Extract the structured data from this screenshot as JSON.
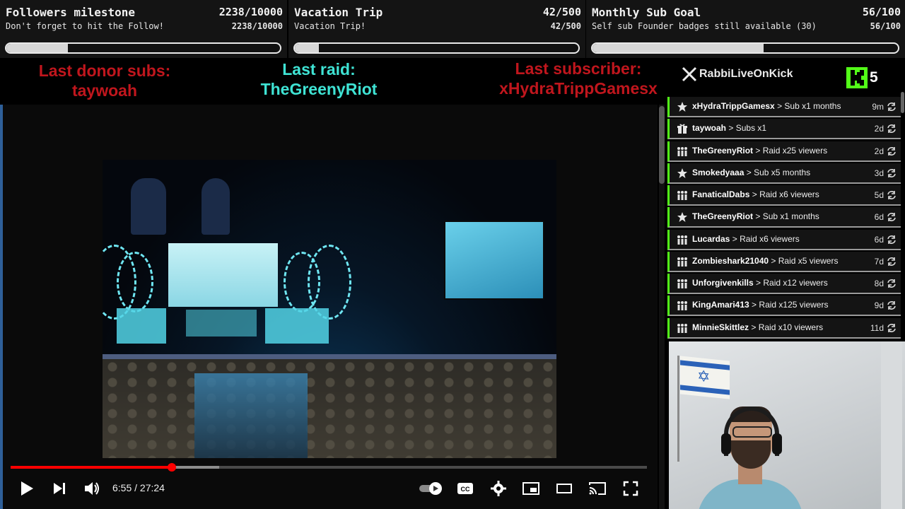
{
  "goals": [
    {
      "title": "Followers milestone",
      "count": "2238/10000",
      "subtitle": "Don't forget to hit the Follow!",
      "sub_count": "2238/10000",
      "progress": 0.2238
    },
    {
      "title": "Vacation Trip",
      "count": "42/500",
      "subtitle": "Vacation Trip!",
      "sub_count": "42/500",
      "progress": 0.084
    },
    {
      "title": "Monthly Sub Goal",
      "count": "56/100",
      "subtitle": "Self sub Founder badges still available (30)",
      "sub_count": "56/100",
      "progress": 0.56
    }
  ],
  "last_events": {
    "donor": {
      "label": "Last donor subs:",
      "value": "taywoah",
      "color": "#c0161d"
    },
    "raid": {
      "label": "Last raid:",
      "value": "TheGreenyRiot",
      "color": "#3fe3d4"
    },
    "subscriber": {
      "label": "Last subscriber:",
      "value": "xHydraTrippGamesx",
      "color": "#c0161d"
    }
  },
  "player": {
    "time": "6:55 / 27:24",
    "played_fraction": 0.253,
    "buffered_fraction": 0.328,
    "colors": {
      "played": "#ff0000",
      "buffered": "#8d8d8d",
      "track": "#4a4a4a"
    }
  },
  "brand": {
    "name": "RabbiLiveOnKick",
    "kick_count": "5",
    "kick_color": "#53fc18"
  },
  "events": [
    {
      "icon": "star-icon",
      "user": "xHydraTrippGamesx",
      "action": "Sub x1 months",
      "time": "9m"
    },
    {
      "icon": "gift-icon",
      "user": "taywoah",
      "action": "Subs x1",
      "time": "2d"
    },
    {
      "icon": "raid-icon",
      "user": "TheGreenyRiot",
      "action": "Raid x25 viewers",
      "time": "2d"
    },
    {
      "icon": "star-icon",
      "user": "Smokedyaaa",
      "action": "Sub x5 months",
      "time": "3d"
    },
    {
      "icon": "raid-icon",
      "user": "FanaticalDabs",
      "action": "Raid x6 viewers",
      "time": "5d"
    },
    {
      "icon": "star-icon",
      "user": "TheGreenyRiot",
      "action": "Sub x1 months",
      "time": "6d"
    },
    {
      "icon": "raid-icon",
      "user": "Lucardas",
      "action": "Raid x6 viewers",
      "time": "6d"
    },
    {
      "icon": "raid-icon",
      "user": "Zombieshark21040",
      "action": "Raid x5 viewers",
      "time": "7d"
    },
    {
      "icon": "raid-icon",
      "user": "Unforgivenkills",
      "action": "Raid x12 viewers",
      "time": "8d"
    },
    {
      "icon": "raid-icon",
      "user": "KingAmari413",
      "action": "Raid x125 viewers",
      "time": "9d"
    },
    {
      "icon": "raid-icon",
      "user": "MinnieSkittlez",
      "action": "Raid x10 viewers",
      "time": "11d"
    }
  ],
  "event_separator": ">"
}
